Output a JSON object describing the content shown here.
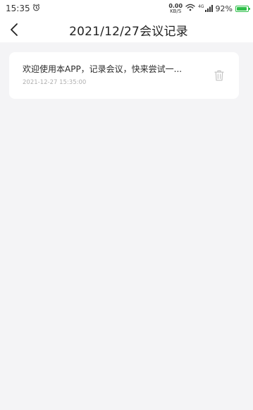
{
  "status_bar": {
    "time": "15:35",
    "net_speed_value": "0.00",
    "net_speed_unit": "KB/S",
    "network_type": "4G",
    "battery_percent": "92%",
    "battery_level": 0.92,
    "battery_color": "#2fbf4a"
  },
  "header": {
    "title": "2021/12/27会议记录",
    "back_icon": "chevron-left-icon"
  },
  "records": [
    {
      "text": "欢迎使用本APP，记录会议，快来尝试一...",
      "time": "2021-12-27 15:35:00",
      "delete_icon": "trash-icon"
    }
  ],
  "colors": {
    "background": "#f4f4f6",
    "card": "#ffffff",
    "meta_text": "#b0b0b0"
  }
}
